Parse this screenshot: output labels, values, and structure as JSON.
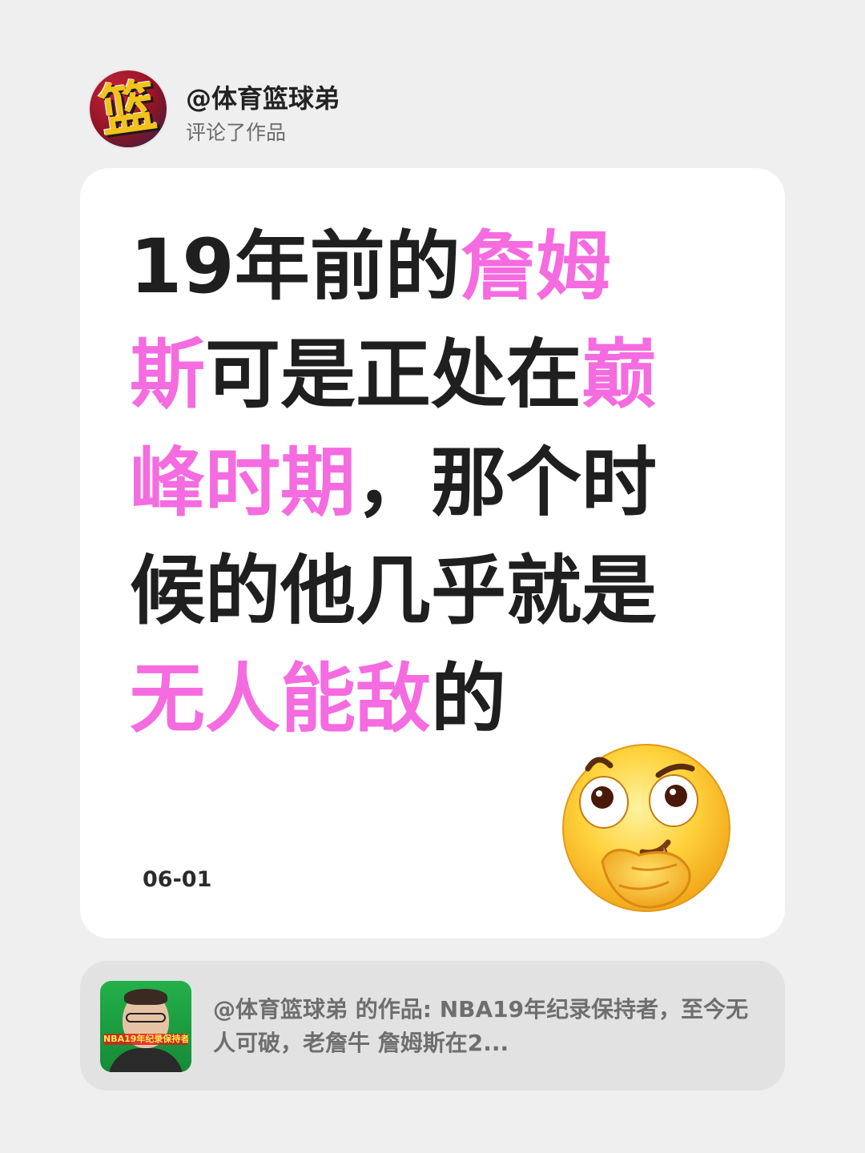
{
  "header": {
    "avatar_glyph": "篮",
    "username": "@体育篮球弟",
    "action": "评论了作品"
  },
  "comment": {
    "segments": [
      {
        "text": "19年前的",
        "highlight": false
      },
      {
        "text": "詹姆斯",
        "highlight": true
      },
      {
        "text": "可是正处在",
        "highlight": false
      },
      {
        "text": "巅峰时期",
        "highlight": true
      },
      {
        "text": "，那个时候的他几乎就是",
        "highlight": false
      },
      {
        "text": "无人能敌",
        "highlight": true
      },
      {
        "text": "的",
        "highlight": false
      }
    ],
    "date": "06-01",
    "emoji_icon": "thinking-face-icon"
  },
  "work": {
    "thumb_caption": "NBA19年纪录保持者",
    "description": "@体育篮球弟 的作品: NBA19年纪录保持者，至今无人可破，老詹牛 詹姆斯在2..."
  },
  "colors": {
    "background": "#efefef",
    "card": "#ffffff",
    "highlight": "#f56be0",
    "text": "#1f1f1f",
    "work_bar": "#e2e2e2"
  }
}
